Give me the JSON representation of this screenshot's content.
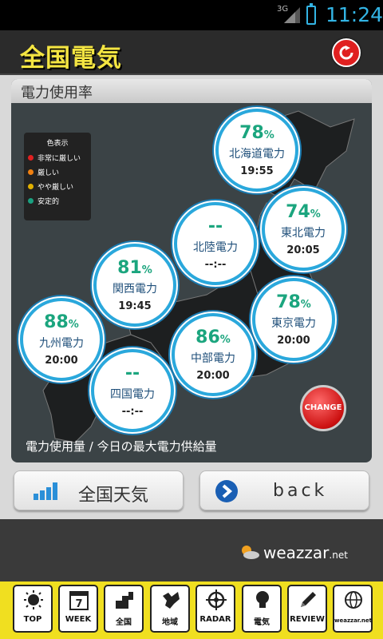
{
  "status_bar": {
    "network": "3G",
    "time": "11:24"
  },
  "header": {
    "title": "全国電気"
  },
  "panel": {
    "title": "電力使用率",
    "footer": "電力使用量 / 今日の最大電力供給量"
  },
  "legend": {
    "title": "色表示",
    "items": [
      {
        "label": "非常に厳しい",
        "color": "#e02020"
      },
      {
        "label": "厳しい",
        "color": "#f08010"
      },
      {
        "label": "やや厳しい",
        "color": "#e0b000"
      },
      {
        "label": "安定的",
        "color": "#1aa080"
      }
    ]
  },
  "regions": [
    {
      "pct": "78",
      "name": "北海道電力",
      "time": "19:55"
    },
    {
      "pct": "74",
      "name": "東北電力",
      "time": "20:05"
    },
    {
      "pct": "--",
      "name": "北陸電力",
      "time": "--:--"
    },
    {
      "pct": "81",
      "name": "関西電力",
      "time": "19:45"
    },
    {
      "pct": "78",
      "name": "東京電力",
      "time": "20:00"
    },
    {
      "pct": "88",
      "name": "九州電力",
      "time": "20:00"
    },
    {
      "pct": "86",
      "name": "中部電力",
      "time": "20:00"
    },
    {
      "pct": "--",
      "name": "四国電力",
      "time": "--:--"
    }
  ],
  "percent_sign": "%",
  "change_button": "CHANGE",
  "buttons": {
    "weather": "全国天気",
    "back": "back"
  },
  "brand": {
    "name": "weazzar",
    "suffix": ".net"
  },
  "tabs": [
    {
      "label": "TOP"
    },
    {
      "label": "WEEK"
    },
    {
      "label": "全国"
    },
    {
      "label": "地域"
    },
    {
      "label": "RADAR"
    },
    {
      "label": "電気"
    },
    {
      "label": "REVIEW"
    },
    {
      "label": "weazzar.net"
    }
  ],
  "tab_icons": {
    "week_number": "7"
  }
}
